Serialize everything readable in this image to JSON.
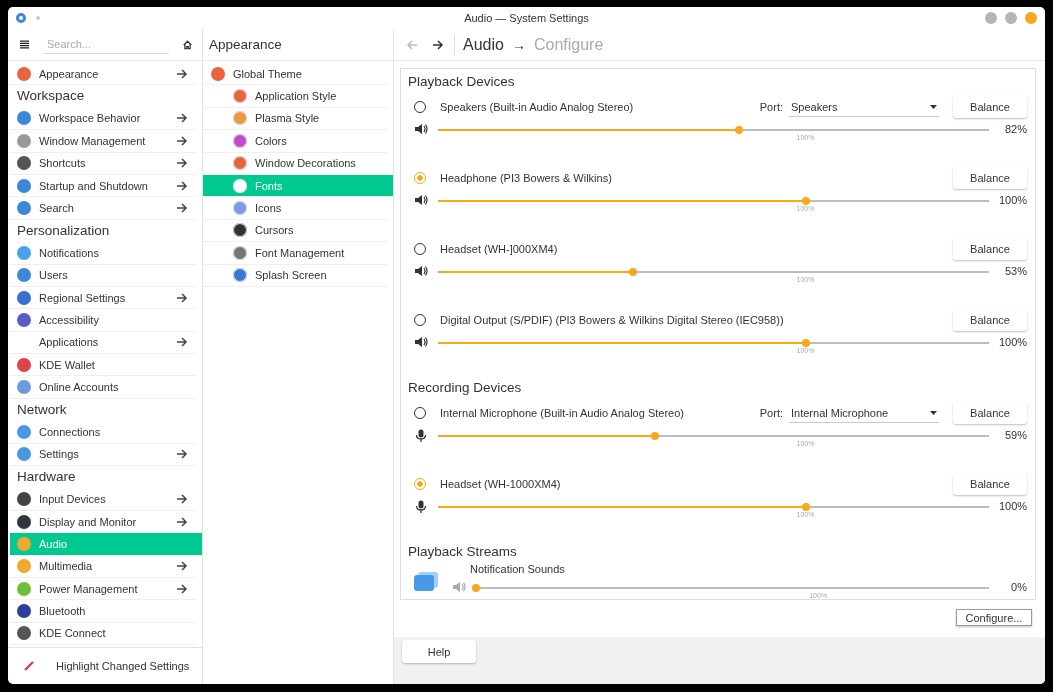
{
  "window": {
    "title": "Audio — System Settings"
  },
  "sidebar": {
    "search": {
      "placeholder": "Search..."
    },
    "items": [
      {
        "kind": "item",
        "label": "Appearance",
        "color": "#e8643c",
        "arrow": true,
        "selected": false
      },
      {
        "kind": "header",
        "label": "Workspace"
      },
      {
        "kind": "item",
        "label": "Workspace Behavior",
        "color": "#3d86d8",
        "arrow": true,
        "selected": false
      },
      {
        "kind": "item",
        "label": "Window Management",
        "color": "#9a9a9a",
        "arrow": true,
        "selected": false
      },
      {
        "kind": "item",
        "label": "Shortcuts",
        "color": "#555555",
        "arrow": true,
        "selected": false
      },
      {
        "kind": "item",
        "label": "Startup and Shutdown",
        "color": "#3d86d8",
        "arrow": true,
        "selected": false
      },
      {
        "kind": "item",
        "label": "Search",
        "color": "#3d86d8",
        "arrow": true,
        "selected": false
      },
      {
        "kind": "header",
        "label": "Personalization"
      },
      {
        "kind": "item",
        "label": "Notifications",
        "color": "#4aa3e8",
        "arrow": false,
        "selected": false
      },
      {
        "kind": "item",
        "label": "Users",
        "color": "#3d86d8",
        "arrow": false,
        "selected": false
      },
      {
        "kind": "item",
        "label": "Regional Settings",
        "color": "#3a6fd0",
        "arrow": true,
        "selected": false
      },
      {
        "kind": "item",
        "label": "Accessibility",
        "color": "#5b5bc8",
        "arrow": false,
        "selected": false
      },
      {
        "kind": "item",
        "label": "Applications",
        "arrow": true,
        "selected": false
      },
      {
        "kind": "item",
        "label": "KDE Wallet",
        "color": "#e04444",
        "arrow": false,
        "selected": false
      },
      {
        "kind": "item",
        "label": "Online Accounts",
        "color": "#6a9be0",
        "arrow": false,
        "selected": false
      },
      {
        "kind": "header",
        "label": "Network"
      },
      {
        "kind": "item",
        "label": "Connections",
        "color": "#4a98e0",
        "arrow": false,
        "selected": false
      },
      {
        "kind": "item",
        "label": "Settings",
        "color": "#4a98e0",
        "arrow": true,
        "selected": false
      },
      {
        "kind": "header",
        "label": "Hardware"
      },
      {
        "kind": "item",
        "label": "Input Devices",
        "color": "#444444",
        "arrow": true,
        "selected": false
      },
      {
        "kind": "item",
        "label": "Display and Monitor",
        "color": "#2f3640",
        "arrow": true,
        "selected": false
      },
      {
        "kind": "item",
        "label": "Audio",
        "color": "#f0a830",
        "arrow": false,
        "selected": true
      },
      {
        "kind": "item",
        "label": "Multimedia",
        "color": "#f0a830",
        "arrow": true,
        "selected": false
      },
      {
        "kind": "item",
        "label": "Power Management",
        "color": "#6cc03c",
        "arrow": true,
        "selected": false
      },
      {
        "kind": "item",
        "label": "Bluetooth",
        "color": "#2e3f9a",
        "arrow": false,
        "selected": false
      },
      {
        "kind": "item",
        "label": "KDE Connect",
        "color": "#555555",
        "arrow": false,
        "selected": false
      }
    ],
    "footer": "Highlight Changed Settings"
  },
  "subpanel": {
    "title": "Appearance",
    "items": [
      {
        "label": "Global Theme",
        "color": "#e8643c",
        "selected": false,
        "children": [
          {
            "label": "Application Style",
            "color": "#e8643c",
            "selected": false
          },
          {
            "label": "Plasma Style",
            "color": "#e89a3c",
            "selected": false
          },
          {
            "label": "Colors",
            "color": "#c04ad0",
            "selected": false
          },
          {
            "label": "Window Decorations",
            "color": "#e8643c",
            "selected": false
          },
          {
            "label": "Fonts",
            "color": "#ffffff",
            "selected": true
          },
          {
            "label": "Icons",
            "color": "#7a9be8",
            "selected": false
          },
          {
            "label": "Cursors",
            "color": "#333333",
            "selected": false
          },
          {
            "label": "Font Management",
            "color": "#777777",
            "selected": false
          },
          {
            "label": "Splash Screen",
            "color": "#3a78d8",
            "selected": false
          }
        ]
      }
    ]
  },
  "breadcrumb": [
    "Audio",
    "→",
    "Configure"
  ],
  "sections": [
    {
      "title": "Playback Devices",
      "devices": [
        {
          "name": "Speakers (Built-in Audio Analog Stereo)",
          "kind": "speaker",
          "selected": false,
          "port_label": "Port:",
          "port": "Speakers",
          "balance": "Balance",
          "level": 0.547,
          "reading": "82%",
          "mark": "100%"
        },
        {
          "name": "Headphone (PI3 Bowers & Wilkins)",
          "kind": "speaker",
          "selected": true,
          "balance": "Balance",
          "level": 0.667,
          "reading": "100%",
          "mark": "100%"
        },
        {
          "name": "Headset (WH-]000XM4)",
          "kind": "speaker",
          "selected": false,
          "balance": "Balance",
          "level": 0.353,
          "reading": "53%",
          "mark": "100%"
        },
        {
          "name": "Digital Output (S/PDIF) (PI3 Bowers & Wilkins Digital Stereo (IEC958))",
          "kind": "speaker",
          "selected": false,
          "balance": "Balance",
          "level": 0.667,
          "reading": "100%",
          "mark": "100%"
        }
      ]
    },
    {
      "title": "Recording Devices",
      "devices": [
        {
          "name": "Internal Microphone (Built-in Audio Analog Stereo)",
          "kind": "mic",
          "selected": false,
          "port_label": "Port:",
          "port": "Internal Microphone",
          "balance": "Balance",
          "level": 0.393,
          "reading": "59%",
          "mark": "100%"
        },
        {
          "name": "Headset (WH-1000XM4)",
          "kind": "mic",
          "selected": true,
          "balance": "Balance",
          "level": 0.667,
          "reading": "100%",
          "mark": "100%"
        }
      ]
    },
    {
      "title": "Playback Streams",
      "streams": [
        {
          "name": "Notification Sounds",
          "level": 0.0,
          "reading": "0%",
          "mark": "100%"
        }
      ]
    }
  ],
  "buttons": {
    "configure": "Configure...",
    "help": "Help"
  }
}
